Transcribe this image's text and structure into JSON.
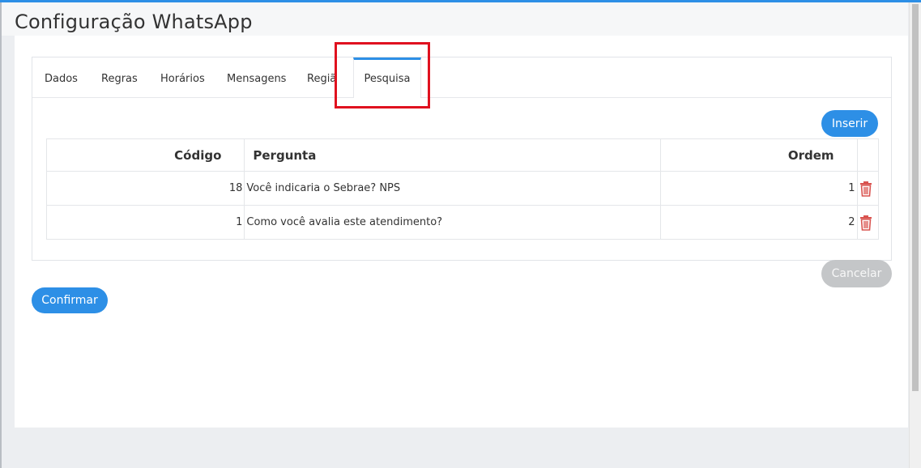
{
  "page": {
    "title": "Configuração WhatsApp"
  },
  "tabs": [
    {
      "label": "Dados"
    },
    {
      "label": "Regras"
    },
    {
      "label": "Horários"
    },
    {
      "label": "Mensagens"
    },
    {
      "label": "Regiã"
    },
    {
      "label": "Pesquisa",
      "active": true
    }
  ],
  "buttons": {
    "insert": "Inserir",
    "cancel": "Cancelar",
    "confirm": "Confirmar"
  },
  "table": {
    "headers": {
      "code": "Código",
      "question": "Pergunta",
      "order": "Ordem"
    },
    "rows": [
      {
        "code": "18",
        "question": "Você indicaria o Sebrae? NPS",
        "order": "1",
        "action_icon": "trash-icon"
      },
      {
        "code": "1",
        "question": "Como você avalia este atendimento?",
        "order": "2",
        "action_icon": "trash-icon"
      }
    ]
  },
  "colors": {
    "accent": "#2d8fe6",
    "delete": "#d9534f",
    "highlight": "#e0111f"
  }
}
